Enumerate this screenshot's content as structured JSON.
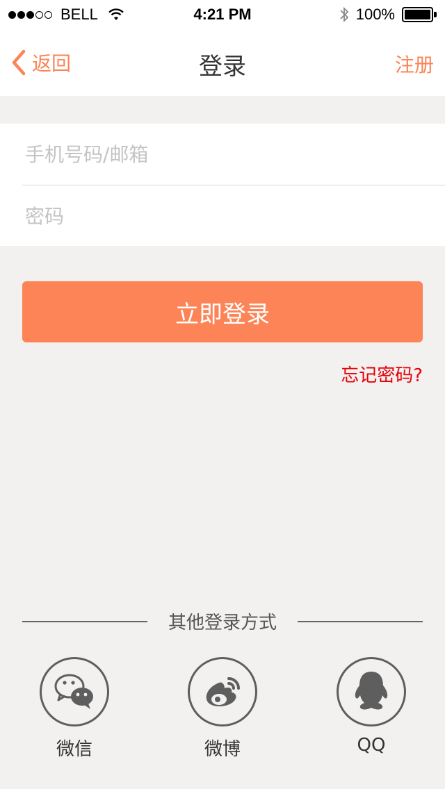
{
  "status_bar": {
    "carrier": "BELL",
    "time": "4:21 PM",
    "battery": "100%",
    "signal_bars_filled": 3,
    "signal_bars_total": 5
  },
  "nav": {
    "back_label": "返回",
    "title": "登录",
    "register_label": "注册"
  },
  "form": {
    "phone_placeholder": "手机号码/邮箱",
    "phone_value": "",
    "password_placeholder": "密码",
    "password_value": ""
  },
  "login_button_label": "立即登录",
  "forgot_password_label": "忘记密码?",
  "other_login": {
    "title": "其他登录方式",
    "options": [
      {
        "label": "微信",
        "icon": "wechat-icon"
      },
      {
        "label": "微博",
        "icon": "weibo-icon"
      },
      {
        "label": "QQ",
        "icon": "qq-icon"
      }
    ]
  },
  "colors": {
    "accent": "#fc8456",
    "forgot_link": "#e6000a",
    "background": "#f2f1ef",
    "icon_gray": "#5e5e5e"
  }
}
